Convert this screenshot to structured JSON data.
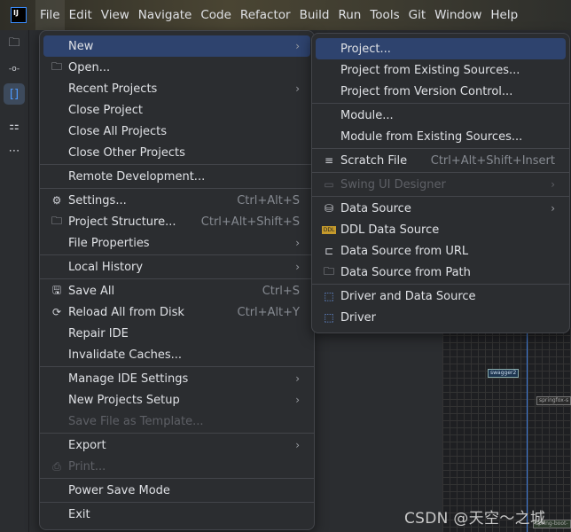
{
  "menubar": {
    "items": [
      "File",
      "Edit",
      "View",
      "Navigate",
      "Code",
      "Refactor",
      "Build",
      "Run",
      "Tools",
      "Git",
      "Window",
      "Help"
    ],
    "active": "File"
  },
  "logo": "IJ",
  "sidebar": {
    "icons": [
      "folder-icon",
      "commit-icon",
      "structure-icon",
      "plugins-icon",
      "more-icon"
    ]
  },
  "file_menu": [
    {
      "label": "New",
      "submenu": true,
      "selected": true
    },
    {
      "label": "Open...",
      "icon": "folder-icon"
    },
    {
      "label": "Recent Projects",
      "submenu": true
    },
    {
      "label": "Close Project"
    },
    {
      "label": "Close All Projects"
    },
    {
      "label": "Close Other Projects"
    },
    {
      "sep": true
    },
    {
      "label": "Remote Development..."
    },
    {
      "sep": true
    },
    {
      "label": "Settings...",
      "icon": "gear-icon",
      "shortcut": "Ctrl+Alt+S"
    },
    {
      "label": "Project Structure...",
      "icon": "project-structure-icon",
      "shortcut": "Ctrl+Alt+Shift+S"
    },
    {
      "label": "File Properties",
      "submenu": true
    },
    {
      "sep": true
    },
    {
      "label": "Local History",
      "submenu": true
    },
    {
      "sep": true
    },
    {
      "label": "Save All",
      "icon": "save-icon",
      "shortcut": "Ctrl+S"
    },
    {
      "label": "Reload All from Disk",
      "icon": "reload-icon",
      "shortcut": "Ctrl+Alt+Y"
    },
    {
      "label": "Repair IDE"
    },
    {
      "label": "Invalidate Caches..."
    },
    {
      "sep": true
    },
    {
      "label": "Manage IDE Settings",
      "submenu": true
    },
    {
      "label": "New Projects Setup",
      "submenu": true
    },
    {
      "label": "Save File as Template...",
      "disabled": true
    },
    {
      "sep": true
    },
    {
      "label": "Export",
      "submenu": true
    },
    {
      "label": "Print...",
      "icon": "print-icon",
      "disabled": true
    },
    {
      "sep": true
    },
    {
      "label": "Power Save Mode"
    },
    {
      "sep": true
    },
    {
      "label": "Exit"
    }
  ],
  "new_submenu": [
    {
      "label": "Project...",
      "selected": true
    },
    {
      "label": "Project from Existing Sources..."
    },
    {
      "label": "Project from Version Control..."
    },
    {
      "sep": true
    },
    {
      "label": "Module..."
    },
    {
      "label": "Module from Existing Sources..."
    },
    {
      "sep": true
    },
    {
      "label": "Scratch File",
      "icon": "scratch-file-icon",
      "shortcut": "Ctrl+Alt+Shift+Insert"
    },
    {
      "sep": true
    },
    {
      "label": "Swing UI Designer",
      "icon": "window-icon",
      "submenu": true,
      "disabled": true
    },
    {
      "sep": true
    },
    {
      "label": "Data Source",
      "icon": "database-icon",
      "submenu": true
    },
    {
      "label": "DDL Data Source",
      "icon": "ddl-icon"
    },
    {
      "label": "Data Source from URL",
      "icon": "plug-icon"
    },
    {
      "label": "Data Source from Path",
      "icon": "folder-icon"
    },
    {
      "sep": true
    },
    {
      "label": "Driver and Data Source",
      "icon": "driver-icon"
    },
    {
      "label": "Driver",
      "icon": "driver-icon"
    }
  ],
  "diagram": {
    "nodes": [
      "swagger2",
      "springfox-s",
      "spring-boot-"
    ]
  },
  "watermark": "CSDN @天空～之城",
  "colors": {
    "accent": "#2e436e",
    "menu_bg": "#2b2d30",
    "link_line": "#3d7de0"
  }
}
